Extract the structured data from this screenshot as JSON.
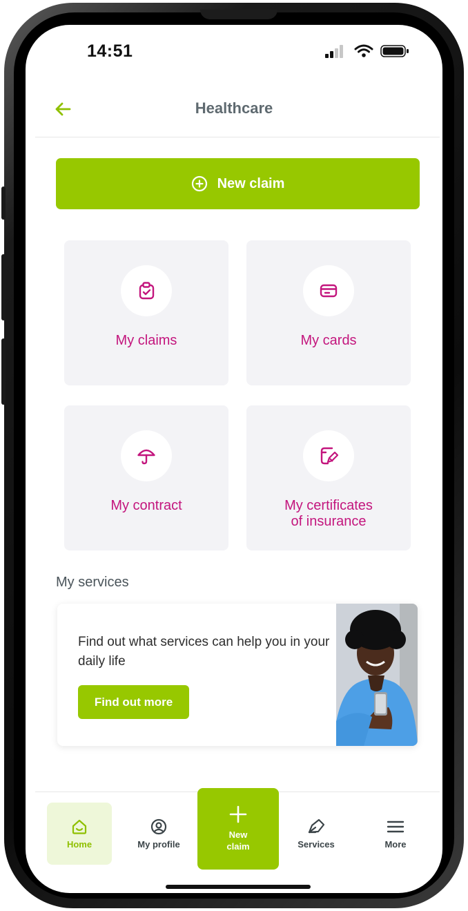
{
  "status_bar": {
    "time": "14:51"
  },
  "header": {
    "title": "Healthcare"
  },
  "new_claim": {
    "label": "New claim"
  },
  "tiles": [
    {
      "label": "My claims",
      "icon": "clipboard-icon"
    },
    {
      "label": "My cards",
      "icon": "card-icon"
    },
    {
      "label": "My contract",
      "icon": "umbrella-icon"
    },
    {
      "label_line1": "My certificates",
      "label_line2": "of insurance",
      "icon": "certificate-icon"
    }
  ],
  "services": {
    "section_title": "My services",
    "card_text": "Find out what services can help you in your daily life",
    "button_label": "Find out more"
  },
  "bottom_nav": {
    "home": "Home",
    "profile": "My profile",
    "new_claim_line1": "New",
    "new_claim_line2": "claim",
    "services": "Services",
    "more": "More"
  },
  "colors": {
    "brand_green": "#97c800",
    "accent_magenta": "#c3157d",
    "tile_background": "#f3f3f6"
  }
}
